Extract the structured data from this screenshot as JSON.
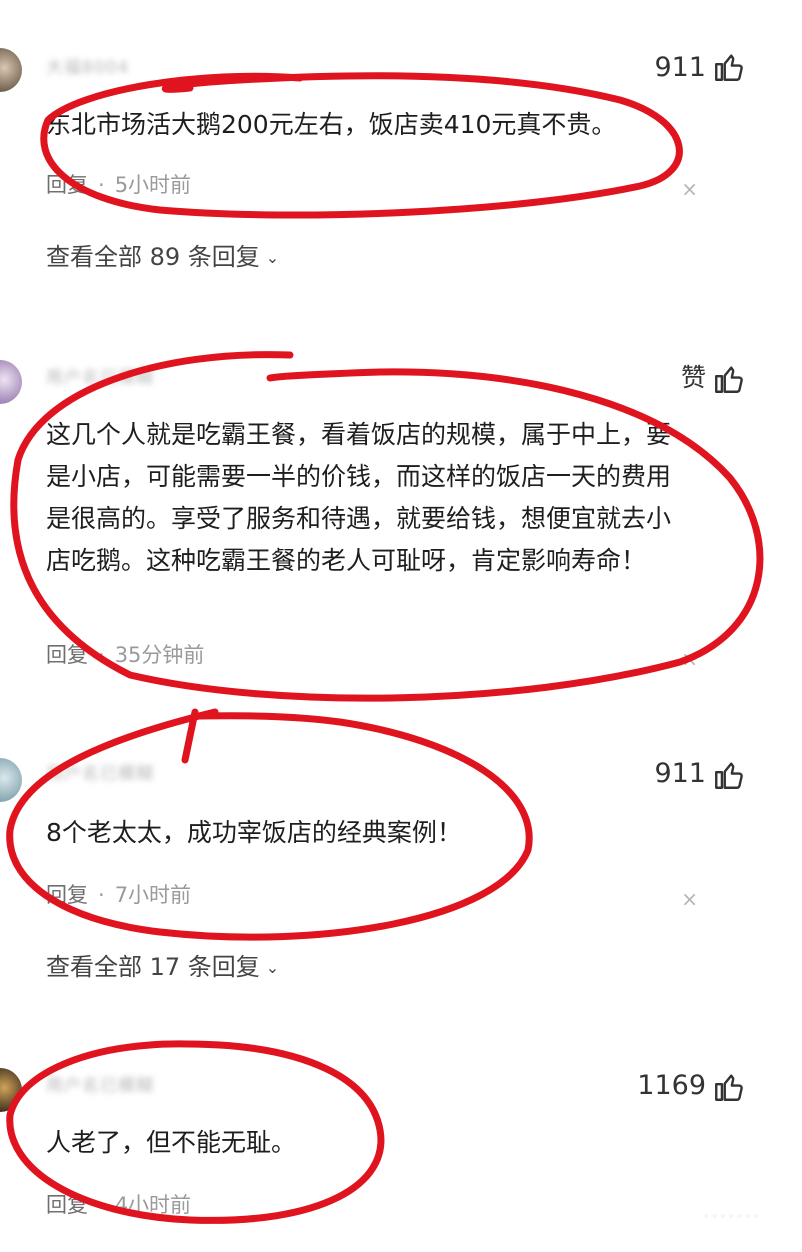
{
  "comments": [
    {
      "username": "大福8004",
      "like_count": "911",
      "text": "东北市场活大鹅200元左右，饭店卖410元真不贵。",
      "reply_label": "回复",
      "time": "5小时前",
      "close_glyph": "×",
      "view_all": "查看全部 89 条回复"
    },
    {
      "username": "用户名已模糊",
      "like_count": "赞",
      "text": "这几个人就是吃霸王餐，看着饭店的规模，属于中上，要是小店，可能需要一半的价钱，而这样的饭店一天的费用是很高的。享受了服务和待遇，就要给钱，想便宜就去小店吃鹅。这种吃霸王餐的老人可耻呀，肯定影响寿命！",
      "reply_label": "回复",
      "time": "35分钟前",
      "close_glyph": "×"
    },
    {
      "username": "用户名已模糊",
      "like_count": "911",
      "text": "8个老太太，成功宰饭店的经典案例！",
      "reply_label": "回复",
      "time": "7小时前",
      "close_glyph": "×",
      "view_all": "查看全部 17 条回复"
    },
    {
      "username": "用户名已模糊",
      "like_count": "1169",
      "text": "人老了，但不能无耻。",
      "reply_label": "回复",
      "time": "4小时前"
    }
  ],
  "separator": "·",
  "view_all_icon": "chevron-down-icon",
  "like_icon": "thumbs-up-icon",
  "annotation_color": "#e0141e"
}
